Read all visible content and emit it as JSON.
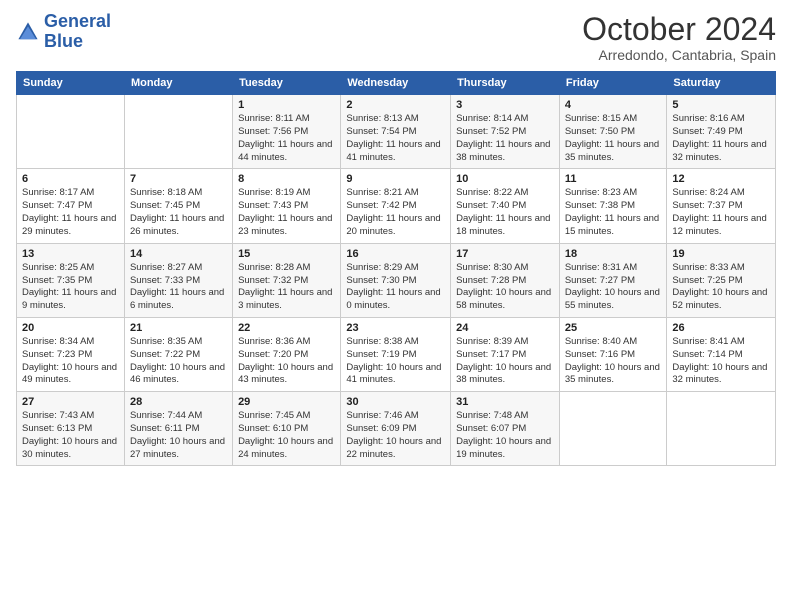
{
  "header": {
    "logo_line1": "General",
    "logo_line2": "Blue",
    "month_title": "October 2024",
    "subtitle": "Arredondo, Cantabria, Spain"
  },
  "days_of_week": [
    "Sunday",
    "Monday",
    "Tuesday",
    "Wednesday",
    "Thursday",
    "Friday",
    "Saturday"
  ],
  "weeks": [
    [
      {
        "day": "",
        "sunrise": "",
        "sunset": "",
        "daylight": ""
      },
      {
        "day": "",
        "sunrise": "",
        "sunset": "",
        "daylight": ""
      },
      {
        "day": "1",
        "sunrise": "Sunrise: 8:11 AM",
        "sunset": "Sunset: 7:56 PM",
        "daylight": "Daylight: 11 hours and 44 minutes."
      },
      {
        "day": "2",
        "sunrise": "Sunrise: 8:13 AM",
        "sunset": "Sunset: 7:54 PM",
        "daylight": "Daylight: 11 hours and 41 minutes."
      },
      {
        "day": "3",
        "sunrise": "Sunrise: 8:14 AM",
        "sunset": "Sunset: 7:52 PM",
        "daylight": "Daylight: 11 hours and 38 minutes."
      },
      {
        "day": "4",
        "sunrise": "Sunrise: 8:15 AM",
        "sunset": "Sunset: 7:50 PM",
        "daylight": "Daylight: 11 hours and 35 minutes."
      },
      {
        "day": "5",
        "sunrise": "Sunrise: 8:16 AM",
        "sunset": "Sunset: 7:49 PM",
        "daylight": "Daylight: 11 hours and 32 minutes."
      }
    ],
    [
      {
        "day": "6",
        "sunrise": "Sunrise: 8:17 AM",
        "sunset": "Sunset: 7:47 PM",
        "daylight": "Daylight: 11 hours and 29 minutes."
      },
      {
        "day": "7",
        "sunrise": "Sunrise: 8:18 AM",
        "sunset": "Sunset: 7:45 PM",
        "daylight": "Daylight: 11 hours and 26 minutes."
      },
      {
        "day": "8",
        "sunrise": "Sunrise: 8:19 AM",
        "sunset": "Sunset: 7:43 PM",
        "daylight": "Daylight: 11 hours and 23 minutes."
      },
      {
        "day": "9",
        "sunrise": "Sunrise: 8:21 AM",
        "sunset": "Sunset: 7:42 PM",
        "daylight": "Daylight: 11 hours and 20 minutes."
      },
      {
        "day": "10",
        "sunrise": "Sunrise: 8:22 AM",
        "sunset": "Sunset: 7:40 PM",
        "daylight": "Daylight: 11 hours and 18 minutes."
      },
      {
        "day": "11",
        "sunrise": "Sunrise: 8:23 AM",
        "sunset": "Sunset: 7:38 PM",
        "daylight": "Daylight: 11 hours and 15 minutes."
      },
      {
        "day": "12",
        "sunrise": "Sunrise: 8:24 AM",
        "sunset": "Sunset: 7:37 PM",
        "daylight": "Daylight: 11 hours and 12 minutes."
      }
    ],
    [
      {
        "day": "13",
        "sunrise": "Sunrise: 8:25 AM",
        "sunset": "Sunset: 7:35 PM",
        "daylight": "Daylight: 11 hours and 9 minutes."
      },
      {
        "day": "14",
        "sunrise": "Sunrise: 8:27 AM",
        "sunset": "Sunset: 7:33 PM",
        "daylight": "Daylight: 11 hours and 6 minutes."
      },
      {
        "day": "15",
        "sunrise": "Sunrise: 8:28 AM",
        "sunset": "Sunset: 7:32 PM",
        "daylight": "Daylight: 11 hours and 3 minutes."
      },
      {
        "day": "16",
        "sunrise": "Sunrise: 8:29 AM",
        "sunset": "Sunset: 7:30 PM",
        "daylight": "Daylight: 11 hours and 0 minutes."
      },
      {
        "day": "17",
        "sunrise": "Sunrise: 8:30 AM",
        "sunset": "Sunset: 7:28 PM",
        "daylight": "Daylight: 10 hours and 58 minutes."
      },
      {
        "day": "18",
        "sunrise": "Sunrise: 8:31 AM",
        "sunset": "Sunset: 7:27 PM",
        "daylight": "Daylight: 10 hours and 55 minutes."
      },
      {
        "day": "19",
        "sunrise": "Sunrise: 8:33 AM",
        "sunset": "Sunset: 7:25 PM",
        "daylight": "Daylight: 10 hours and 52 minutes."
      }
    ],
    [
      {
        "day": "20",
        "sunrise": "Sunrise: 8:34 AM",
        "sunset": "Sunset: 7:23 PM",
        "daylight": "Daylight: 10 hours and 49 minutes."
      },
      {
        "day": "21",
        "sunrise": "Sunrise: 8:35 AM",
        "sunset": "Sunset: 7:22 PM",
        "daylight": "Daylight: 10 hours and 46 minutes."
      },
      {
        "day": "22",
        "sunrise": "Sunrise: 8:36 AM",
        "sunset": "Sunset: 7:20 PM",
        "daylight": "Daylight: 10 hours and 43 minutes."
      },
      {
        "day": "23",
        "sunrise": "Sunrise: 8:38 AM",
        "sunset": "Sunset: 7:19 PM",
        "daylight": "Daylight: 10 hours and 41 minutes."
      },
      {
        "day": "24",
        "sunrise": "Sunrise: 8:39 AM",
        "sunset": "Sunset: 7:17 PM",
        "daylight": "Daylight: 10 hours and 38 minutes."
      },
      {
        "day": "25",
        "sunrise": "Sunrise: 8:40 AM",
        "sunset": "Sunset: 7:16 PM",
        "daylight": "Daylight: 10 hours and 35 minutes."
      },
      {
        "day": "26",
        "sunrise": "Sunrise: 8:41 AM",
        "sunset": "Sunset: 7:14 PM",
        "daylight": "Daylight: 10 hours and 32 minutes."
      }
    ],
    [
      {
        "day": "27",
        "sunrise": "Sunrise: 7:43 AM",
        "sunset": "Sunset: 6:13 PM",
        "daylight": "Daylight: 10 hours and 30 minutes."
      },
      {
        "day": "28",
        "sunrise": "Sunrise: 7:44 AM",
        "sunset": "Sunset: 6:11 PM",
        "daylight": "Daylight: 10 hours and 27 minutes."
      },
      {
        "day": "29",
        "sunrise": "Sunrise: 7:45 AM",
        "sunset": "Sunset: 6:10 PM",
        "daylight": "Daylight: 10 hours and 24 minutes."
      },
      {
        "day": "30",
        "sunrise": "Sunrise: 7:46 AM",
        "sunset": "Sunset: 6:09 PM",
        "daylight": "Daylight: 10 hours and 22 minutes."
      },
      {
        "day": "31",
        "sunrise": "Sunrise: 7:48 AM",
        "sunset": "Sunset: 6:07 PM",
        "daylight": "Daylight: 10 hours and 19 minutes."
      },
      {
        "day": "",
        "sunrise": "",
        "sunset": "",
        "daylight": ""
      },
      {
        "day": "",
        "sunrise": "",
        "sunset": "",
        "daylight": ""
      }
    ]
  ]
}
